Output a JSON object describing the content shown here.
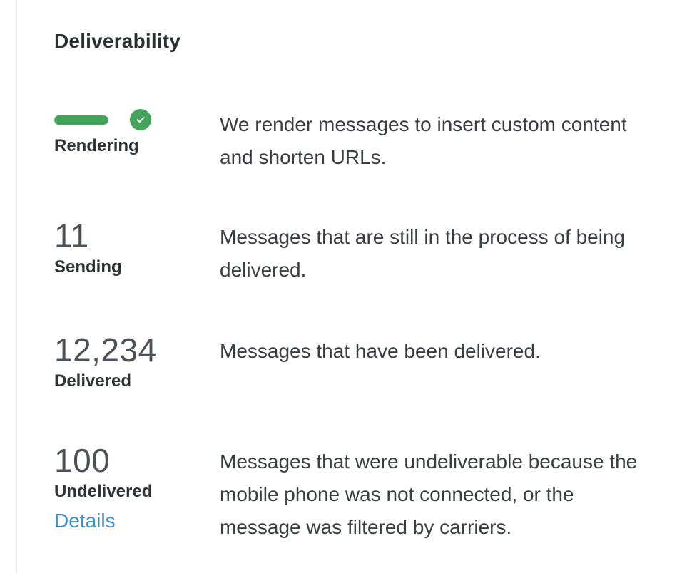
{
  "section": {
    "title": "Deliverability"
  },
  "rendering": {
    "label": "Rendering",
    "progress_percent": 100,
    "status_icon": "check-circle-icon",
    "status_color": "#43a35b",
    "description": "We render messages to insert custom content and shorten URLs."
  },
  "sending": {
    "count": "11",
    "label": "Sending",
    "description": "Messages that are still in the process of being delivered."
  },
  "delivered": {
    "count": "12,234",
    "label": "Delivered",
    "description": "Messages that have been delivered."
  },
  "undelivered": {
    "count": "100",
    "label": "Undelivered",
    "link_label": "Details",
    "link_color": "#3d8fc4",
    "description": "Messages that were undeliverable because the mobile phone was not connected, or the message was filtered by carriers."
  }
}
